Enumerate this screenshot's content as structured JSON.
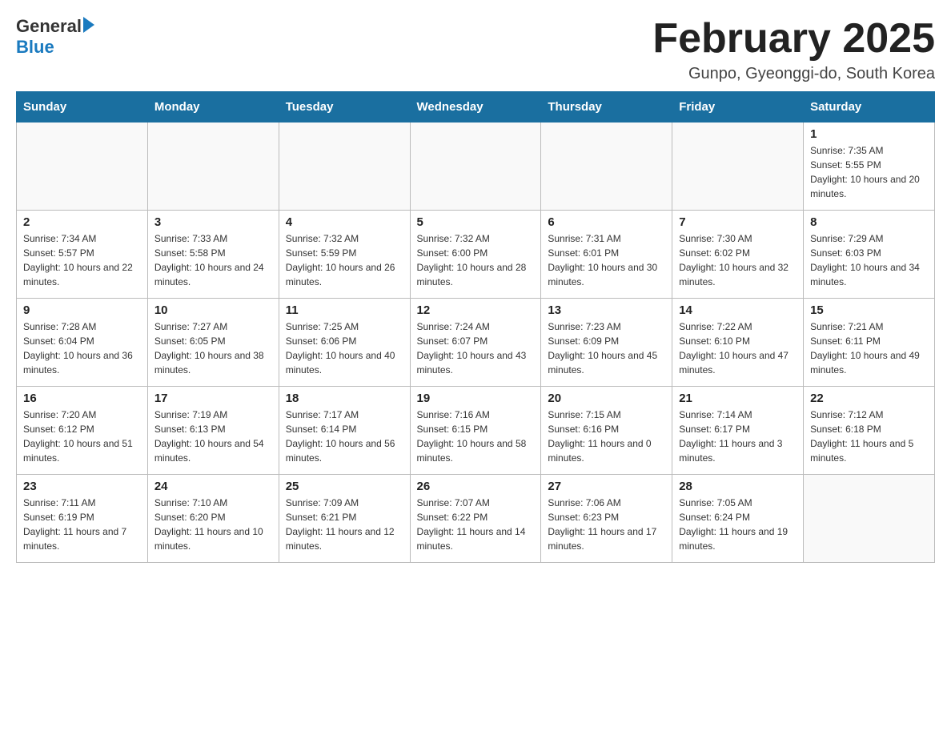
{
  "header": {
    "title": "February 2025",
    "subtitle": "Gunpo, Gyeonggi-do, South Korea",
    "logo": {
      "general": "General",
      "blue": "Blue"
    }
  },
  "days_of_week": [
    "Sunday",
    "Monday",
    "Tuesday",
    "Wednesday",
    "Thursday",
    "Friday",
    "Saturday"
  ],
  "weeks": [
    [
      {
        "day": "",
        "sunrise": "",
        "sunset": "",
        "daylight": ""
      },
      {
        "day": "",
        "sunrise": "",
        "sunset": "",
        "daylight": ""
      },
      {
        "day": "",
        "sunrise": "",
        "sunset": "",
        "daylight": ""
      },
      {
        "day": "",
        "sunrise": "",
        "sunset": "",
        "daylight": ""
      },
      {
        "day": "",
        "sunrise": "",
        "sunset": "",
        "daylight": ""
      },
      {
        "day": "",
        "sunrise": "",
        "sunset": "",
        "daylight": ""
      },
      {
        "day": "1",
        "sunrise": "Sunrise: 7:35 AM",
        "sunset": "Sunset: 5:55 PM",
        "daylight": "Daylight: 10 hours and 20 minutes."
      }
    ],
    [
      {
        "day": "2",
        "sunrise": "Sunrise: 7:34 AM",
        "sunset": "Sunset: 5:57 PM",
        "daylight": "Daylight: 10 hours and 22 minutes."
      },
      {
        "day": "3",
        "sunrise": "Sunrise: 7:33 AM",
        "sunset": "Sunset: 5:58 PM",
        "daylight": "Daylight: 10 hours and 24 minutes."
      },
      {
        "day": "4",
        "sunrise": "Sunrise: 7:32 AM",
        "sunset": "Sunset: 5:59 PM",
        "daylight": "Daylight: 10 hours and 26 minutes."
      },
      {
        "day": "5",
        "sunrise": "Sunrise: 7:32 AM",
        "sunset": "Sunset: 6:00 PM",
        "daylight": "Daylight: 10 hours and 28 minutes."
      },
      {
        "day": "6",
        "sunrise": "Sunrise: 7:31 AM",
        "sunset": "Sunset: 6:01 PM",
        "daylight": "Daylight: 10 hours and 30 minutes."
      },
      {
        "day": "7",
        "sunrise": "Sunrise: 7:30 AM",
        "sunset": "Sunset: 6:02 PM",
        "daylight": "Daylight: 10 hours and 32 minutes."
      },
      {
        "day": "8",
        "sunrise": "Sunrise: 7:29 AM",
        "sunset": "Sunset: 6:03 PM",
        "daylight": "Daylight: 10 hours and 34 minutes."
      }
    ],
    [
      {
        "day": "9",
        "sunrise": "Sunrise: 7:28 AM",
        "sunset": "Sunset: 6:04 PM",
        "daylight": "Daylight: 10 hours and 36 minutes."
      },
      {
        "day": "10",
        "sunrise": "Sunrise: 7:27 AM",
        "sunset": "Sunset: 6:05 PM",
        "daylight": "Daylight: 10 hours and 38 minutes."
      },
      {
        "day": "11",
        "sunrise": "Sunrise: 7:25 AM",
        "sunset": "Sunset: 6:06 PM",
        "daylight": "Daylight: 10 hours and 40 minutes."
      },
      {
        "day": "12",
        "sunrise": "Sunrise: 7:24 AM",
        "sunset": "Sunset: 6:07 PM",
        "daylight": "Daylight: 10 hours and 43 minutes."
      },
      {
        "day": "13",
        "sunrise": "Sunrise: 7:23 AM",
        "sunset": "Sunset: 6:09 PM",
        "daylight": "Daylight: 10 hours and 45 minutes."
      },
      {
        "day": "14",
        "sunrise": "Sunrise: 7:22 AM",
        "sunset": "Sunset: 6:10 PM",
        "daylight": "Daylight: 10 hours and 47 minutes."
      },
      {
        "day": "15",
        "sunrise": "Sunrise: 7:21 AM",
        "sunset": "Sunset: 6:11 PM",
        "daylight": "Daylight: 10 hours and 49 minutes."
      }
    ],
    [
      {
        "day": "16",
        "sunrise": "Sunrise: 7:20 AM",
        "sunset": "Sunset: 6:12 PM",
        "daylight": "Daylight: 10 hours and 51 minutes."
      },
      {
        "day": "17",
        "sunrise": "Sunrise: 7:19 AM",
        "sunset": "Sunset: 6:13 PM",
        "daylight": "Daylight: 10 hours and 54 minutes."
      },
      {
        "day": "18",
        "sunrise": "Sunrise: 7:17 AM",
        "sunset": "Sunset: 6:14 PM",
        "daylight": "Daylight: 10 hours and 56 minutes."
      },
      {
        "day": "19",
        "sunrise": "Sunrise: 7:16 AM",
        "sunset": "Sunset: 6:15 PM",
        "daylight": "Daylight: 10 hours and 58 minutes."
      },
      {
        "day": "20",
        "sunrise": "Sunrise: 7:15 AM",
        "sunset": "Sunset: 6:16 PM",
        "daylight": "Daylight: 11 hours and 0 minutes."
      },
      {
        "day": "21",
        "sunrise": "Sunrise: 7:14 AM",
        "sunset": "Sunset: 6:17 PM",
        "daylight": "Daylight: 11 hours and 3 minutes."
      },
      {
        "day": "22",
        "sunrise": "Sunrise: 7:12 AM",
        "sunset": "Sunset: 6:18 PM",
        "daylight": "Daylight: 11 hours and 5 minutes."
      }
    ],
    [
      {
        "day": "23",
        "sunrise": "Sunrise: 7:11 AM",
        "sunset": "Sunset: 6:19 PM",
        "daylight": "Daylight: 11 hours and 7 minutes."
      },
      {
        "day": "24",
        "sunrise": "Sunrise: 7:10 AM",
        "sunset": "Sunset: 6:20 PM",
        "daylight": "Daylight: 11 hours and 10 minutes."
      },
      {
        "day": "25",
        "sunrise": "Sunrise: 7:09 AM",
        "sunset": "Sunset: 6:21 PM",
        "daylight": "Daylight: 11 hours and 12 minutes."
      },
      {
        "day": "26",
        "sunrise": "Sunrise: 7:07 AM",
        "sunset": "Sunset: 6:22 PM",
        "daylight": "Daylight: 11 hours and 14 minutes."
      },
      {
        "day": "27",
        "sunrise": "Sunrise: 7:06 AM",
        "sunset": "Sunset: 6:23 PM",
        "daylight": "Daylight: 11 hours and 17 minutes."
      },
      {
        "day": "28",
        "sunrise": "Sunrise: 7:05 AM",
        "sunset": "Sunset: 6:24 PM",
        "daylight": "Daylight: 11 hours and 19 minutes."
      },
      {
        "day": "",
        "sunrise": "",
        "sunset": "",
        "daylight": ""
      }
    ]
  ]
}
